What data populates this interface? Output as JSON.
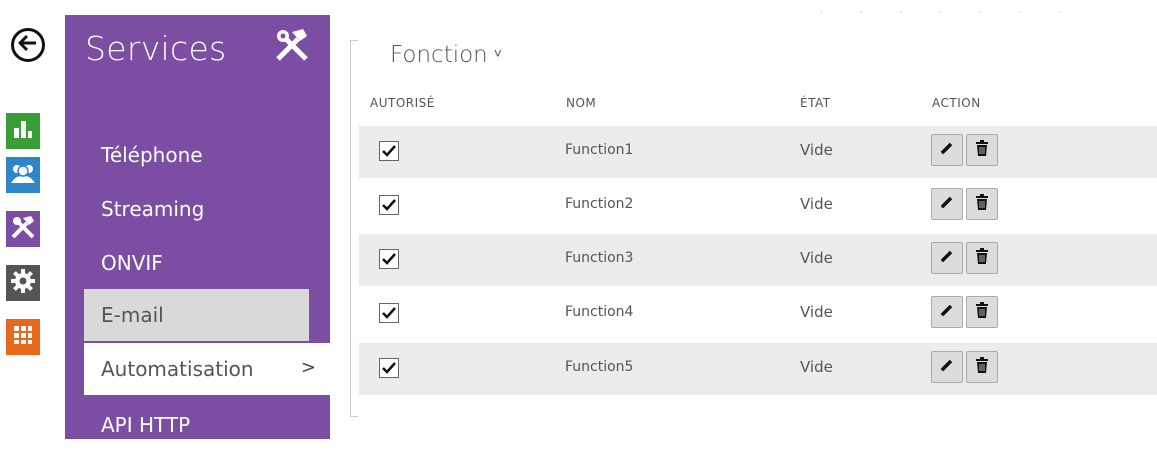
{
  "rail": {
    "icons": [
      "back-arrow-icon",
      "stats-icon",
      "users-icon",
      "tools-icon",
      "gear-icon",
      "grid-icon"
    ],
    "colors": {
      "stats": "#3a9c35",
      "users": "#2e86c9",
      "tools": "#7b4ea3",
      "gear": "#555555",
      "grid": "#e8691e"
    }
  },
  "sidebar": {
    "title": "Services",
    "accent": "#7b4ea3",
    "items": [
      {
        "label": "Téléphone"
      },
      {
        "label": "Streaming"
      },
      {
        "label": "ONVIF"
      },
      {
        "label": "E-mail",
        "state": "hover"
      },
      {
        "label": "Automatisation",
        "state": "active",
        "chevron": ">"
      },
      {
        "label": "API HTTP"
      }
    ]
  },
  "main": {
    "section_title": "Fonction",
    "caret": "˅",
    "top_dots": "· · · · · · ·",
    "columns": {
      "enabled": "AUTORISÉ",
      "name": "NOM",
      "state": "ÉTAT",
      "action": "ACTION"
    },
    "rows": [
      {
        "name": "Function1",
        "state": "Vide",
        "checked": true
      },
      {
        "name": "Function2",
        "state": "Vide",
        "checked": true
      },
      {
        "name": "Function3",
        "state": "Vide",
        "checked": true
      },
      {
        "name": "Function4",
        "state": "Vide",
        "checked": true
      },
      {
        "name": "Function5",
        "state": "Vide",
        "checked": true
      }
    ]
  }
}
